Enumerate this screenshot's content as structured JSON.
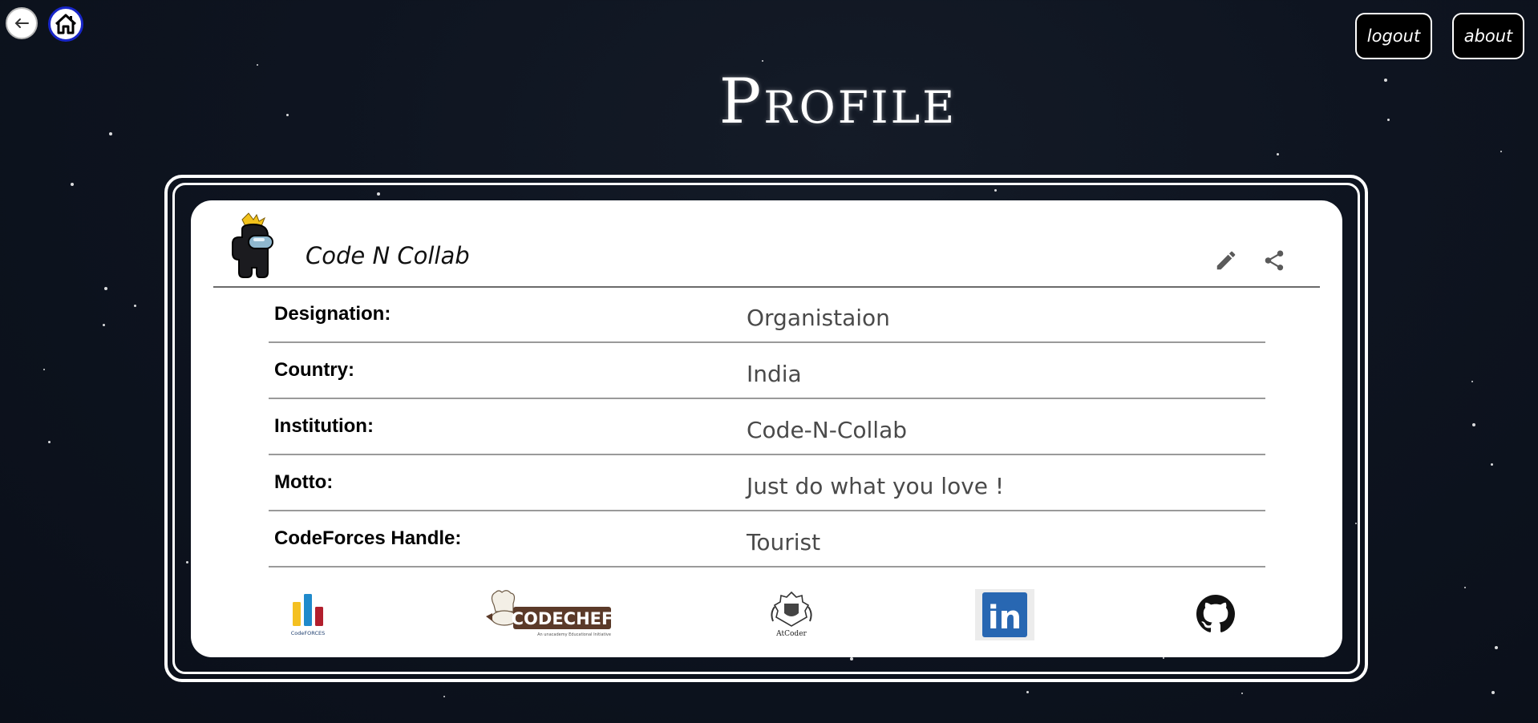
{
  "nav": {
    "back_icon": "arrow-left-icon",
    "home_icon": "home-icon"
  },
  "header_buttons": {
    "logout_label": "logout",
    "about_label": "about"
  },
  "page": {
    "title": "Profile"
  },
  "profile": {
    "name": "Code N Collab",
    "avatar_icon": "among-us-avatar-icon",
    "actions": [
      "edit-icon",
      "share-icon"
    ],
    "fields": [
      {
        "label": "Designation:",
        "value": "Organistaion"
      },
      {
        "label": "Country:",
        "value": "India"
      },
      {
        "label": "Institution:",
        "value": "Code-N-Collab"
      },
      {
        "label": "Motto:",
        "value": "Just do what you love !"
      },
      {
        "label": "CodeForces Handle:",
        "value": "Tourist"
      }
    ]
  },
  "links": {
    "codeforces": {
      "wordmark": "CodeFORCES"
    },
    "codechef": {
      "wordmark": "CODECHEF",
      "tagline": "An unacademy Educational Initiative"
    },
    "atcoder": {
      "wordmark": "AtCoder"
    },
    "linkedin": {
      "wordmark": "in"
    },
    "github": {
      "icon": "github-icon"
    }
  },
  "colors": {
    "background": "#0e1420",
    "card": "#ffffff",
    "home_ring": "#1826c8",
    "linkedin": "#2867b2",
    "codechef_brown": "#5b3a29"
  }
}
